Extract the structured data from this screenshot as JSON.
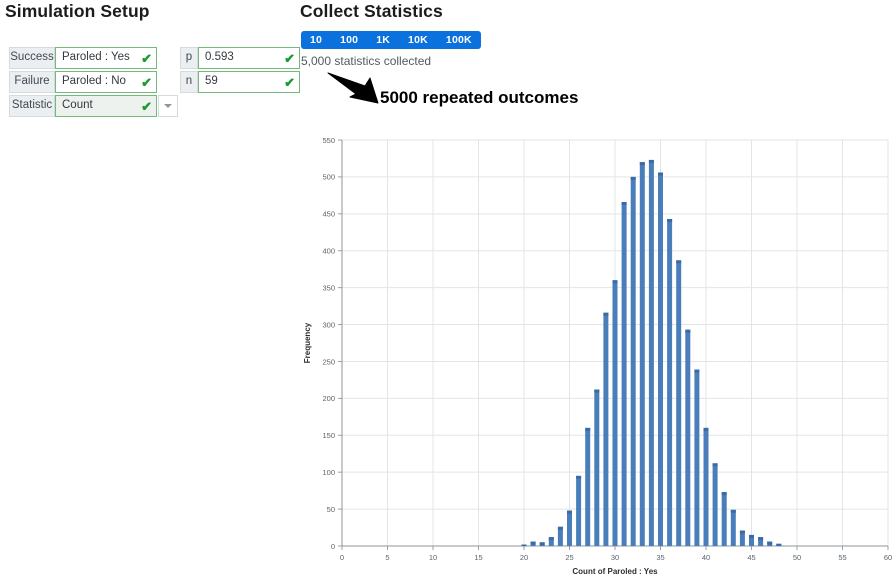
{
  "simulation_setup": {
    "title": "Simulation Setup",
    "rows": [
      {
        "label": "Success",
        "value": "Paroled : Yes",
        "check": "✔",
        "has_caret": false,
        "muted": false
      },
      {
        "label": "Failure",
        "value": "Paroled : No",
        "check": "✔",
        "has_caret": false,
        "muted": false
      },
      {
        "label": "Statistic",
        "value": "Count",
        "check": "✔",
        "has_caret": true,
        "muted": true
      }
    ],
    "params": [
      {
        "label": "p",
        "value": "0.593",
        "check": "✔"
      },
      {
        "label": "n",
        "value": "59",
        "check": "✔"
      }
    ]
  },
  "collect_statistics": {
    "title": "Collect Statistics",
    "segments": [
      "10",
      "100",
      "1K",
      "10K",
      "100K"
    ],
    "status": "5,000 statistics collected",
    "accent_color": "#0b72dd"
  },
  "annotation": {
    "text": "5000 repeated outcomes",
    "color": "#000000"
  },
  "chart_data": {
    "type": "bar",
    "title": "",
    "xlabel": "Count of Paroled : Yes",
    "ylabel": "Frequency",
    "xlim": [
      0,
      60
    ],
    "ylim": [
      0,
      550
    ],
    "xticks": [
      0,
      5,
      10,
      15,
      20,
      25,
      30,
      35,
      40,
      45,
      50,
      55,
      60
    ],
    "yticks": [
      0,
      50,
      100,
      150,
      200,
      250,
      300,
      350,
      400,
      450,
      500,
      550
    ],
    "grid": true,
    "legend": "none",
    "bar_color": "#4a7ebb",
    "categories": [
      20,
      21,
      22,
      23,
      24,
      25,
      26,
      27,
      28,
      29,
      30,
      31,
      32,
      33,
      34,
      35,
      36,
      37,
      38,
      39,
      40,
      41,
      42,
      43,
      44,
      45,
      46,
      47,
      48
    ],
    "values": [
      2,
      6,
      5,
      12,
      26,
      48,
      95,
      160,
      212,
      316,
      360,
      466,
      500,
      520,
      523,
      506,
      443,
      387,
      293,
      239,
      160,
      112,
      73,
      49,
      21,
      15,
      12,
      6,
      3
    ]
  }
}
